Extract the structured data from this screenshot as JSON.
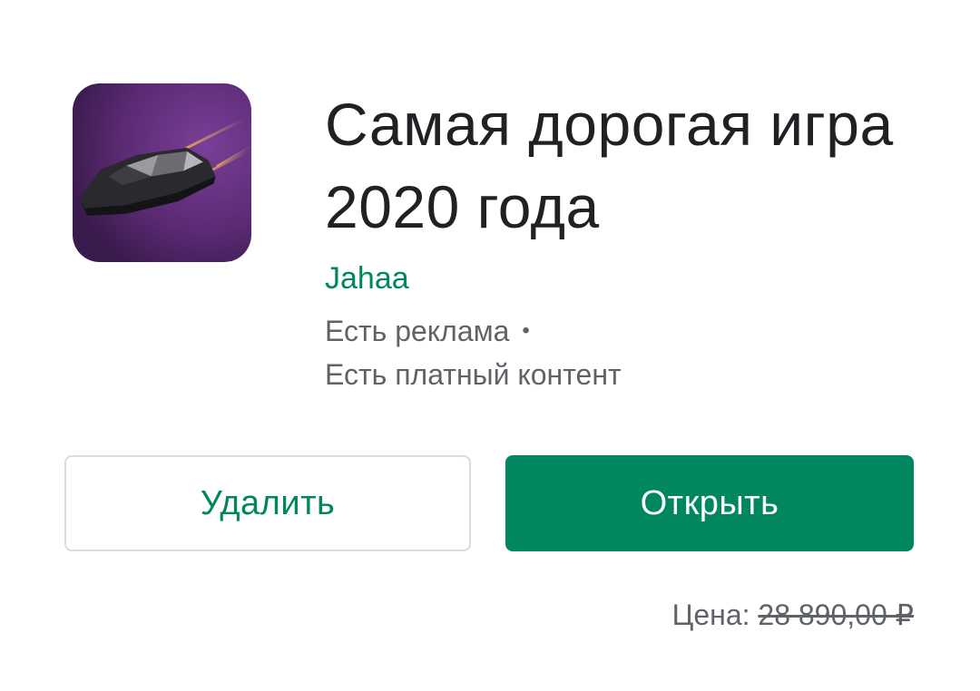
{
  "app": {
    "icon_name": "hovercar-icon",
    "title": "Самая дорогая игра 2020 года",
    "developer": "Jahaa",
    "contains_ads": "Есть реклама",
    "separator": "•",
    "in_app_purchases": "Есть платный контент"
  },
  "actions": {
    "uninstall_label": "Удалить",
    "open_label": "Открыть"
  },
  "price": {
    "label": "Цена:",
    "value": "28 890,00 ₽",
    "strikethrough": true
  },
  "colors": {
    "accent": "#01875f",
    "title": "#202124",
    "secondary_text": "#5f6368",
    "button_border": "#dadce0",
    "icon_background": "#5b2a73"
  }
}
